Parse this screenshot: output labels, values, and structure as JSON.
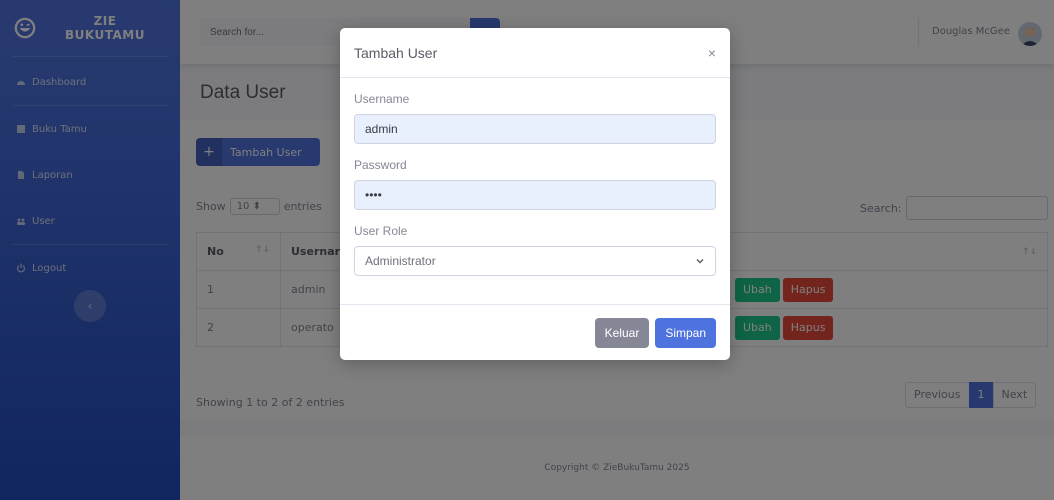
{
  "sidebar": {
    "brand_line1": "ZIE",
    "brand_line2": "BUKUTAMU",
    "items": [
      {
        "label": "Dashboard",
        "icon": "dashboard-icon"
      },
      {
        "label": "Buku Tamu",
        "icon": "book-icon"
      },
      {
        "label": "Laporan",
        "icon": "file-icon"
      },
      {
        "label": "User",
        "icon": "users-icon"
      },
      {
        "label": "Logout",
        "icon": "power-icon"
      }
    ],
    "toggle": "‹"
  },
  "topbar": {
    "search_placeholder": "Search for...",
    "user_name": "Douglas McGee"
  },
  "page": {
    "title": "Data User",
    "add_button": "Tambah User",
    "show": "Show",
    "entries_value": "10",
    "entries": "entries",
    "search_label": "Search:",
    "columns": [
      "No",
      "Usernar"
    ],
    "rows": [
      {
        "no": "1",
        "username": "admin"
      },
      {
        "no": "2",
        "username": "operato"
      }
    ],
    "edit_label": "Ubah",
    "delete_label": "Hapus",
    "info": "Showing 1 to 2 of 2 entries",
    "pagination": {
      "previous": "Previous",
      "current": "1",
      "next": "Next"
    },
    "footer": "Copyright © ZieBukuTamu 2025"
  },
  "modal": {
    "title": "Tambah User",
    "close": "×",
    "username_label": "Username",
    "username_value": "admin",
    "password_label": "Password",
    "password_value": "••••",
    "role_label": "User Role",
    "role_value": "Administrator",
    "cancel": "Keluar",
    "submit": "Simpan"
  },
  "colors": {
    "primary": "#4e73df",
    "success": "#1cc88a",
    "danger": "#e74a3b",
    "secondary": "#858796"
  }
}
